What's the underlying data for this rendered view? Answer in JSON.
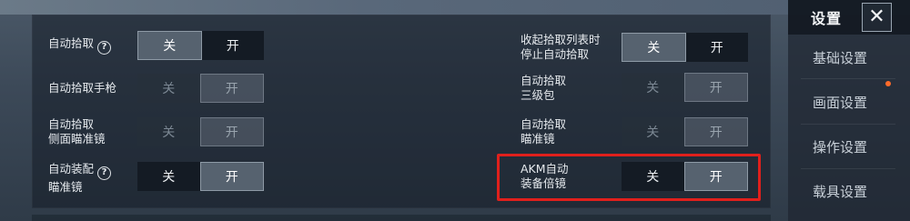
{
  "sidebar": {
    "title": "设置",
    "close_label": "✕",
    "items": [
      {
        "label": "基础设置"
      },
      {
        "label": "画面设置"
      },
      {
        "label": "操作设置"
      },
      {
        "label": "载具设置"
      }
    ]
  },
  "settings": {
    "auto_pickup": {
      "label": "自动拾取",
      "help": "?",
      "off": "关",
      "on": "开",
      "state": "off"
    },
    "auto_pickup_pistol": {
      "label": "自动拾取手枪",
      "off": "关",
      "on": "开",
      "state": "disabled-on"
    },
    "auto_pickup_side_scope": {
      "label_line1": "自动拾取",
      "label_line2": "侧面瞄准镜",
      "off": "关",
      "on": "开",
      "state": "disabled-on"
    },
    "auto_equip_scope": {
      "label_line1": "自动装配",
      "label_line2": "瞄准镜",
      "help": "?",
      "off": "关",
      "on": "开",
      "state": "on"
    },
    "stop_pickup_when_collapsed": {
      "label_line1": "收起拾取列表时",
      "label_line2": "停止自动拾取",
      "off": "关",
      "on": "开",
      "state": "off"
    },
    "auto_pickup_lvl3_bag": {
      "label_line1": "自动拾取",
      "label_line2": "三级包",
      "off": "关",
      "on": "开",
      "state": "disabled-on"
    },
    "auto_pickup_scope": {
      "label_line1": "自动拾取",
      "label_line2": "瞄准镜",
      "off": "关",
      "on": "开",
      "state": "disabled-on"
    },
    "akm_auto_equip_scope": {
      "label_line1": "AKM自动",
      "label_line2": "装备倍镜",
      "off": "关",
      "on": "开",
      "state": "on"
    }
  },
  "colors": {
    "highlight": "#e0201c",
    "notify_dot": "#ff6b2a"
  }
}
